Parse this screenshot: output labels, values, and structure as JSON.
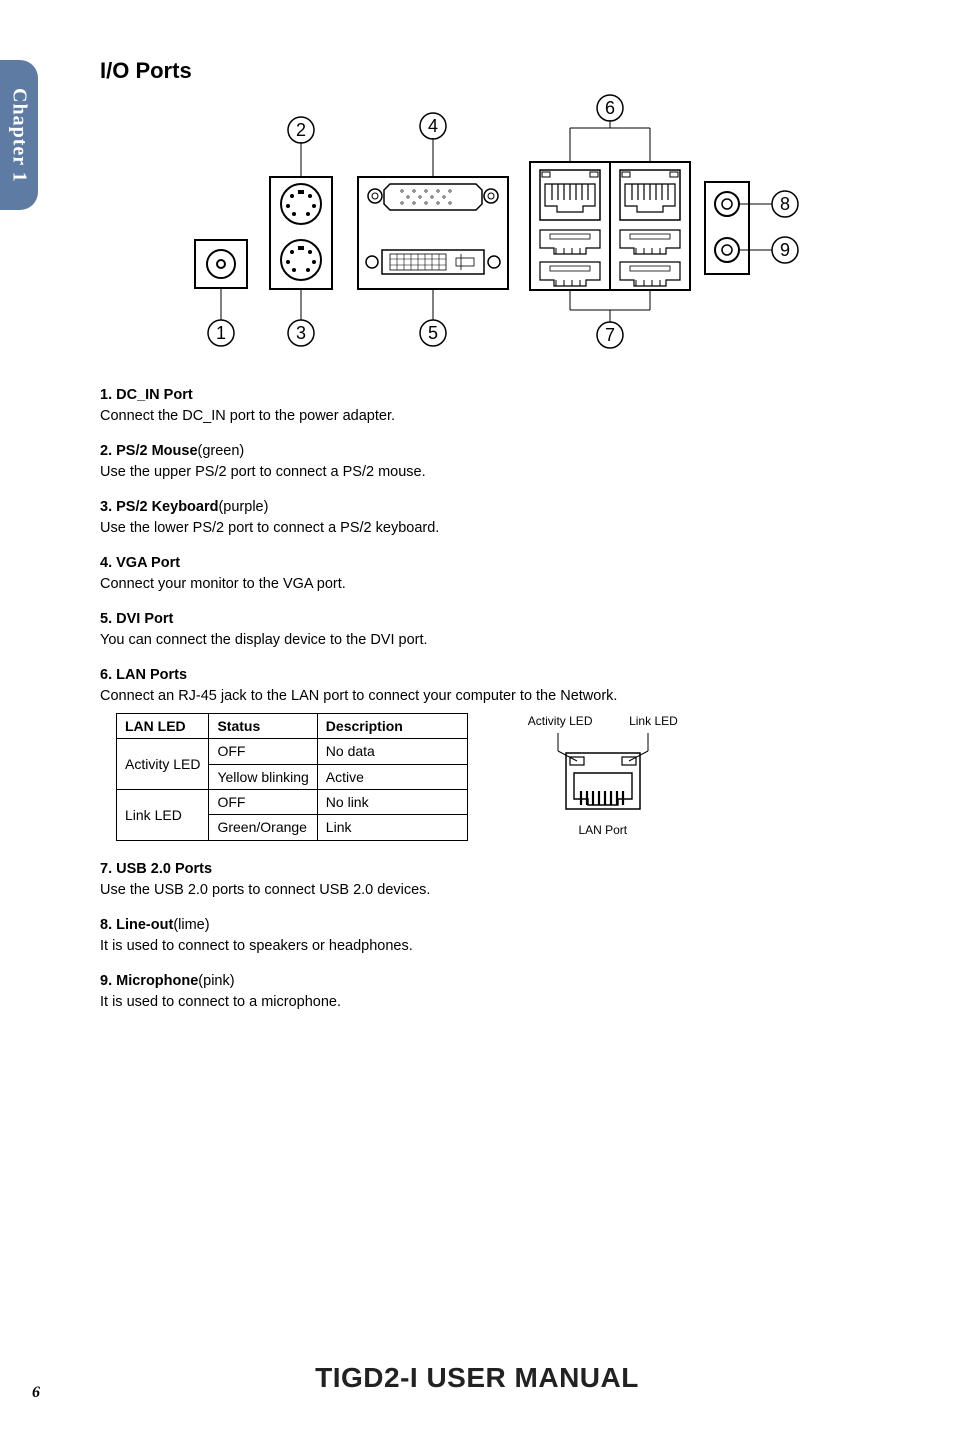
{
  "sidebar": {
    "label": "Chapter 1"
  },
  "heading": "I/O Ports",
  "diagram": {
    "callouts": [
      "1",
      "2",
      "3",
      "4",
      "5",
      "6",
      "7",
      "8",
      "9"
    ]
  },
  "sections": [
    {
      "num": "1.",
      "title": "DC_IN Port",
      "suffix": "",
      "body": "Connect the DC_IN port to the power adapter."
    },
    {
      "num": "2.",
      "title": "PS/2 Mouse",
      "suffix": "(green)",
      "body": "Use the upper PS/2 port to connect a PS/2 mouse."
    },
    {
      "num": "3.",
      "title": "PS/2 Keyboard",
      "suffix": "(purple)",
      "body": "Use the lower PS/2 port to connect a PS/2 keyboard."
    },
    {
      "num": "4.",
      "title": "VGA Port",
      "suffix": "",
      "body": "Connect your monitor to the VGA port."
    },
    {
      "num": "5.",
      "title": "DVI Port",
      "suffix": "",
      "body": "You can connect the display device to the DVI port."
    },
    {
      "num": "6.",
      "title": "LAN Ports",
      "suffix": "",
      "body": "Connect an RJ-45 jack to the LAN port to connect your computer to the Network."
    },
    {
      "num": "7.",
      "title": "USB 2.0 Ports",
      "suffix": "",
      "body": "Use the USB 2.0 ports to connect USB 2.0 devices."
    },
    {
      "num": "8.",
      "title": "Line-out",
      "suffix": "(lime)",
      "body": "It is used to connect to speakers or headphones."
    },
    {
      "num": "9.",
      "title": "Microphone",
      "suffix": "(pink)",
      "body": "It is used to connect to a microphone."
    }
  ],
  "led_table": {
    "headers": [
      "LAN LED",
      "Status",
      "Description"
    ],
    "rows": [
      {
        "group": "Activity LED",
        "status": "OFF",
        "desc": "No data"
      },
      {
        "group": "Activity LED",
        "status": "Yellow blinking",
        "desc": "Active"
      },
      {
        "group": "Link LED",
        "status": "OFF",
        "desc": "No link"
      },
      {
        "group": "Link LED",
        "status": "Green/Orange",
        "desc": "Link"
      }
    ]
  },
  "lan_diagram": {
    "left_label": "Activity LED",
    "right_label": "Link LED",
    "caption": "LAN Port"
  },
  "footer": {
    "title": "TIGD2-I  USER MANUAL"
  },
  "page_number": "6"
}
